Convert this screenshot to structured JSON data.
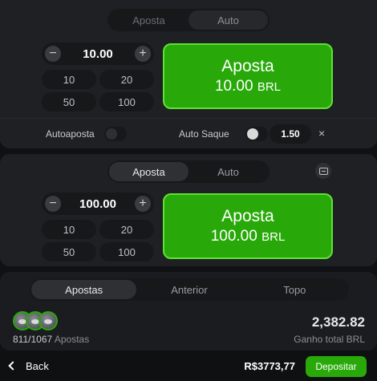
{
  "bet_panel_1": {
    "tabs": [
      {
        "label": "Aposta",
        "active": false
      },
      {
        "label": "Auto",
        "active": true
      }
    ],
    "amount": "10.00",
    "quick_amounts": [
      "10",
      "20",
      "50",
      "100"
    ],
    "bet_button": {
      "line1": "Aposta",
      "amount": "10.00",
      "currency": "BRL"
    },
    "autobet": {
      "label": "Autoaposta",
      "on": false
    },
    "auto_cashout": {
      "label": "Auto Saque",
      "on": true,
      "value": "1.50",
      "close": "×"
    }
  },
  "bet_panel_2": {
    "tabs": [
      {
        "label": "Aposta",
        "active": true
      },
      {
        "label": "Auto",
        "active": false
      }
    ],
    "amount": "100.00",
    "quick_amounts": [
      "10",
      "20",
      "50",
      "100"
    ],
    "bet_button": {
      "line1": "Aposta",
      "amount": "100.00",
      "currency": "BRL"
    }
  },
  "stats_panel": {
    "tabs": [
      {
        "label": "Apostas",
        "active": true
      },
      {
        "label": "Anterior",
        "active": false
      },
      {
        "label": "Topo",
        "active": false
      }
    ],
    "bets_count": "811/1067",
    "bets_label": "Apostas",
    "total_win": "2,382.82",
    "total_win_label": "Ganho total BRL"
  },
  "bottom_bar": {
    "back_label": "Back",
    "balance": "R$3773,77",
    "deposit_label": "Depositar"
  },
  "icons": {
    "minus": "minus-icon",
    "plus": "plus-icon",
    "close": "close-icon",
    "collapse": "collapse-icon",
    "back": "chevron-left-icon"
  },
  "colors": {
    "accent_green": "#28a909",
    "accent_green_border": "#5fe035",
    "panel_bg": "#1f2023",
    "page_bg": "#101113"
  }
}
